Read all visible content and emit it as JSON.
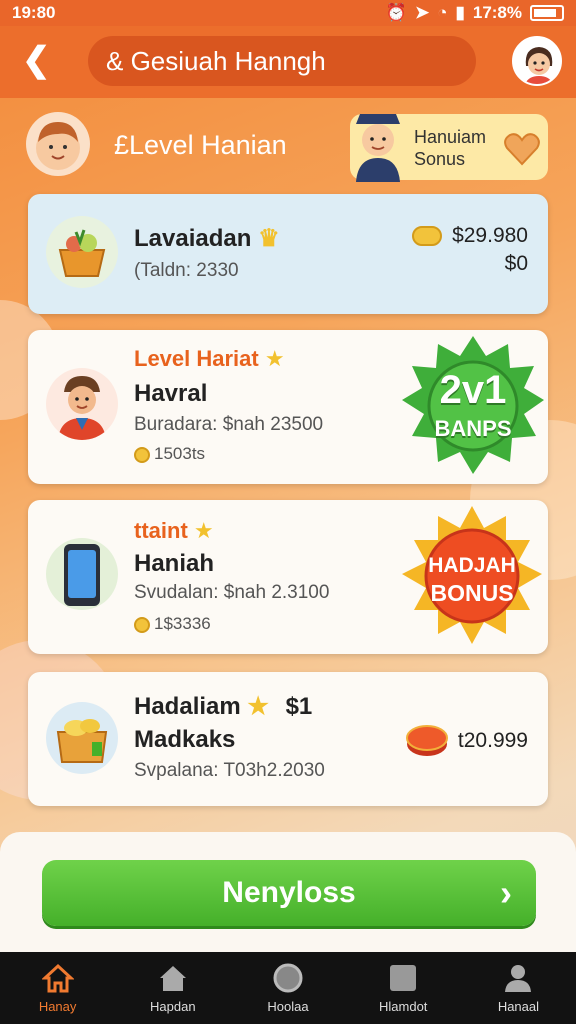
{
  "status": {
    "time": "19:80",
    "battery": "17:8%"
  },
  "header": {
    "search_text": "& Gesiuah Hanngh"
  },
  "level": {
    "title": "£Level Hanian",
    "badge_line1": "Hanuiam",
    "badge_line2": "Sonus"
  },
  "cards": [
    {
      "title": "Lavaiadan",
      "subtitle": "(Taldn: 2330",
      "price1": "$29.980",
      "price2": "$0"
    },
    {
      "tag": "Level Hariat",
      "title": "Havral",
      "subtitle": "Buradara: $nah 23500",
      "coins": "1503ts",
      "burst_line1": "2v1",
      "burst_line2": "BANPS"
    },
    {
      "tag": "ttaint",
      "title": "Haniah",
      "subtitle": "Svudalan: $nah 2.3100",
      "coins": "1$3336",
      "burst_line1": "HADJAH",
      "burst_line2": "BONUS"
    },
    {
      "title": "Hadaliam",
      "price_inline": "$1",
      "title2": "Madkaks",
      "subtitle": "Svpalana: T03h2.2030",
      "price": "t20.999"
    }
  ],
  "cta": {
    "label": "Nenyloss"
  },
  "nav": [
    {
      "label": "Hanay",
      "icon": "home-icon"
    },
    {
      "label": "Hapdan",
      "icon": "house-icon"
    },
    {
      "label": "Hoolaa",
      "icon": "circle-icon"
    },
    {
      "label": "Hlamdot",
      "icon": "square-icon"
    },
    {
      "label": "Hanaal",
      "icon": "person-icon"
    }
  ]
}
